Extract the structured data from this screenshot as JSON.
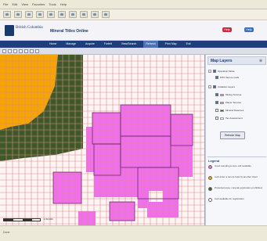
{
  "browser": {
    "menu": [
      "File",
      "Edit",
      "View",
      "Favorites",
      "Tools",
      "Help"
    ],
    "toolbar_icons": [
      "back-icon",
      "forward-icon",
      "stop-icon",
      "refresh-icon",
      "home-icon",
      "search-icon",
      "favorites-icon",
      "history-icon",
      "mail-icon",
      "print-icon"
    ]
  },
  "header": {
    "logo_text": "British Columbia",
    "app_title": "Mineral Titles Online",
    "help_red_label": "Help",
    "help_blue_label": "Help"
  },
  "nav": {
    "tabs": [
      "Home",
      "Manage",
      "Acquire",
      "Forfeit",
      "View/Search",
      "Refresh",
      "Print Map",
      "Exit"
    ],
    "active_tab": "Refresh"
  },
  "map": {
    "colors": {
      "orange": "#f5a400",
      "dark_green": "#3f5a2a",
      "magenta": "#f06ef0",
      "grid_line": "#e08a8a",
      "cell_outline": "#6b2a6b"
    },
    "scale_text": "1:50,000"
  },
  "panel": {
    "title": "Map Layers",
    "close_icon": "close-icon",
    "layers": [
      {
        "label": "Operation Mode",
        "checked": true,
        "group": true
      },
      {
        "label": "MTO Tenure Cells",
        "checked": true,
        "group": false
      },
      {
        "label": "Cadastre Layers",
        "checked": true,
        "group": true
      },
      {
        "label": "Mining Tenures",
        "checked": true,
        "group": false
      },
      {
        "label": "Placer Tenures",
        "checked": true,
        "group": false
      },
      {
        "label": "Mineral Reserves",
        "checked": false,
        "group": false
      },
      {
        "label": "Tax Assessment",
        "checked": false,
        "group": false
      }
    ],
    "refresh_label": "Refresh Map",
    "legend_title": "Legend",
    "legend_items": [
      {
        "text": "Good standing tenure cell available",
        "color": "#f06ef0"
      },
      {
        "text": "Cell under a tenure held by another client",
        "color": "#f5a400"
      },
      {
        "text": "Protected area, mineral exploration prohibited",
        "color": "#3f5a2a"
      },
      {
        "text": "Cell available for registration",
        "color": "#ffffff"
      }
    ]
  },
  "status": {
    "text": "Done"
  }
}
